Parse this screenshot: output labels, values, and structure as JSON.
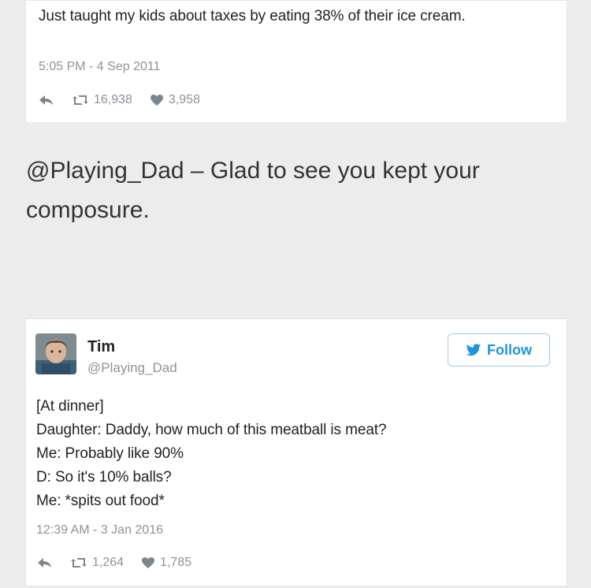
{
  "tweet1": {
    "text": "Just taught my kids about taxes by eating 38% of their ice cream.",
    "timestamp": "5:05 PM - 4 Sep 2011",
    "retweets": "16,938",
    "likes": "3,958"
  },
  "caption": "@Playing_Dad – Glad to see you kept your composure.",
  "tweet2": {
    "name": "Tim",
    "handle": "@Playing_Dad",
    "follow_label": "Follow",
    "lines": [
      "[At dinner]",
      "Daughter: Daddy, how much of this meatball is meat?",
      "Me: Probably like 90%",
      "D: So it's 10% balls?",
      "Me: *spits out food*"
    ],
    "timestamp": "12:39 AM - 3 Jan 2016",
    "retweets": "1,264",
    "likes": "1,785"
  },
  "colors": {
    "background": "#ececec",
    "card": "#ffffff",
    "text": "#222222",
    "muted": "#8a939b",
    "twitter_blue": "#1b95e0"
  },
  "icons": {
    "reply": "reply-arrow-icon",
    "retweet": "retweet-icon",
    "like": "heart-icon",
    "follow": "twitter-bird-icon"
  }
}
